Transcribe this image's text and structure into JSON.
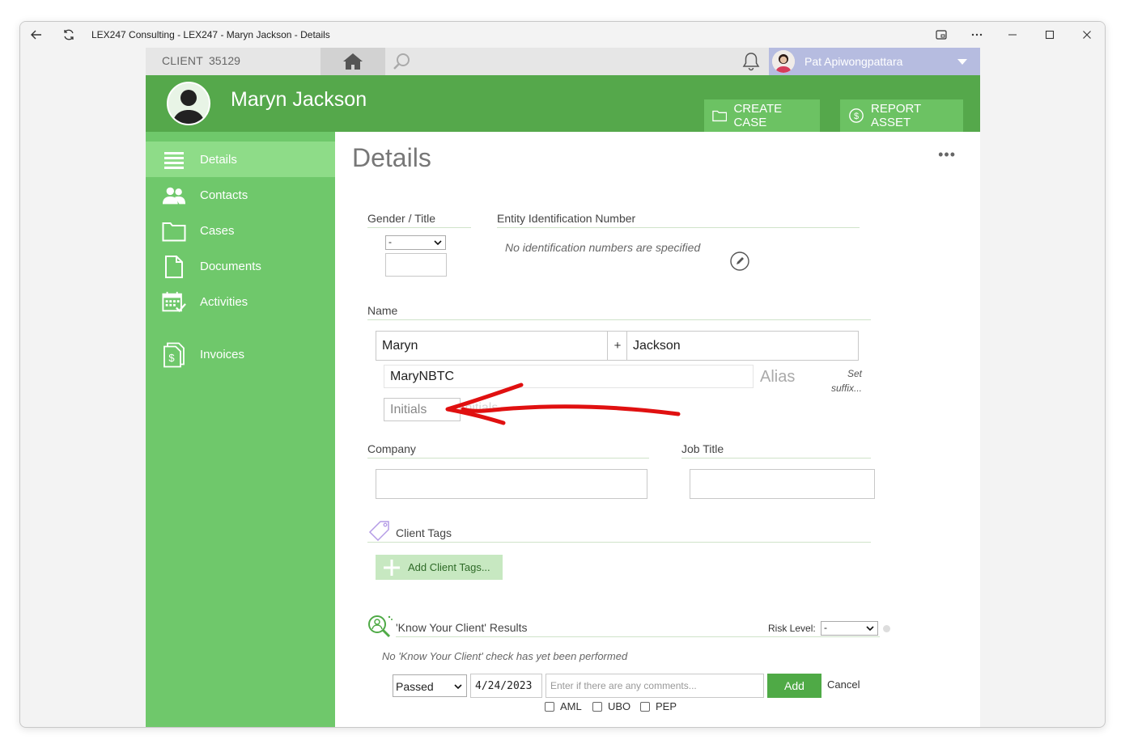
{
  "window": {
    "title": "LEX247 Consulting - LEX247 - Maryn Jackson - Details"
  },
  "topbar": {
    "client_label": "CLIENT",
    "client_id": "35129",
    "user_name": "Pat Apiwongpattara"
  },
  "header": {
    "client_name": "Maryn Jackson",
    "create_case_label": "CREATE CASE",
    "report_asset_label": "REPORT ASSET"
  },
  "sidebar": {
    "items": [
      {
        "label": "Details",
        "icon": "list-icon"
      },
      {
        "label": "Contacts",
        "icon": "people-icon"
      },
      {
        "label": "Cases",
        "icon": "folder-icon"
      },
      {
        "label": "Documents",
        "icon": "document-icon"
      },
      {
        "label": "Activities",
        "icon": "calendar-check-icon"
      },
      {
        "label": "Invoices",
        "icon": "invoice-icon"
      }
    ]
  },
  "main": {
    "title": "Details",
    "more_label": "•••",
    "gender_title": {
      "label": "Gender / Title",
      "selected": "-"
    },
    "entity_id": {
      "label": "Entity Identification Number",
      "empty_text": "No identification numbers are specified"
    },
    "name": {
      "label": "Name",
      "first": "Maryn",
      "plus": "+",
      "last": "Jackson",
      "alias_value": "MaryNBTC",
      "alias_label": "Alias",
      "set_suffix": "Set suffix...",
      "initials_placeholder": "Initials",
      "initials_ghost": "Initials"
    },
    "company": {
      "label": "Company",
      "value": ""
    },
    "job_title": {
      "label": "Job Title",
      "value": ""
    },
    "client_tags": {
      "label": "Client Tags",
      "add_label": "Add Client Tags..."
    },
    "kyc": {
      "label": "'Know Your Client' Results",
      "risk_label": "Risk Level:",
      "risk_selected": "-",
      "empty_text": "No 'Know Your Client' check has yet been performed",
      "result_selected": "Passed",
      "date": "4/24/2023",
      "comments_placeholder": "Enter if there are any comments...",
      "add_label": "Add",
      "cancel_label": "Cancel",
      "checks": [
        "AML",
        "UBO",
        "PEP"
      ]
    }
  },
  "colors": {
    "header_green": "#55a84b",
    "sidebar_green": "#6fc86b",
    "active_green": "#8edc88",
    "user_box": "#b6bce0",
    "annotation_red": "#e01010"
  }
}
